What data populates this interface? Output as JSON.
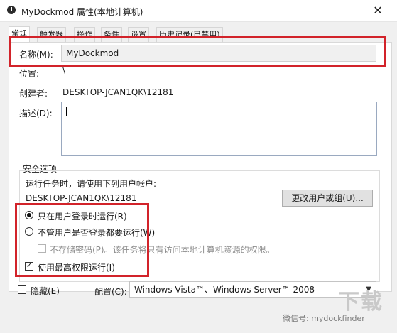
{
  "window": {
    "title": "MyDockmod 属性(本地计算机)",
    "close_glyph": "✕"
  },
  "tabs": [
    {
      "label": "常规"
    },
    {
      "label": "触发器"
    },
    {
      "label": "操作"
    },
    {
      "label": "条件"
    },
    {
      "label": "设置"
    },
    {
      "label": "历史记录(已禁用)"
    }
  ],
  "general": {
    "name_label": "名称(M):",
    "name_value": "MyDockmod",
    "location_label": "位置:",
    "location_value": "\\",
    "author_label": "创建者:",
    "author_value": "DESKTOP-JCAN1QK\\12181",
    "description_label": "描述(D):",
    "description_value": ""
  },
  "security": {
    "group_label": "安全选项",
    "run_as_label": "运行任务时，请使用下列用户帐户:",
    "user_account": "DESKTOP-JCAN1QK\\12181",
    "change_user_button": "更改用户或组(U)...",
    "option_logged_on": "只在用户登录时运行(R)",
    "option_any": "不管用户是否登录都要运行(W)",
    "option_no_store_password": "不存储密码(P)。该任务将只有访问本地计算机资源的权限。",
    "option_highest_privileges": "使用最高权限运行(I)",
    "selected_option": "option_logged_on",
    "highest_privileges_checked": true
  },
  "footer": {
    "hidden_label": "隐藏(E)",
    "configure_label": "配置(C):",
    "configure_value": "Windows Vista™、Windows Server™ 2008"
  },
  "watermark": {
    "text": "微信号: mydockfinder",
    "logo": "下载"
  },
  "colors": {
    "highlight_box": "#d2232a"
  }
}
